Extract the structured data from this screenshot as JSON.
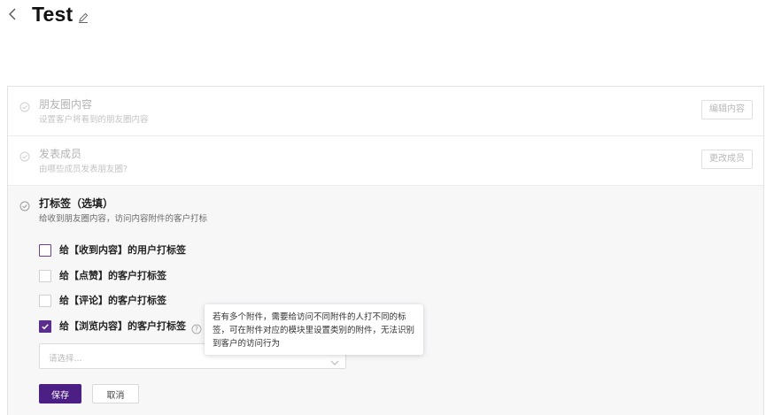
{
  "header": {
    "title": "Test"
  },
  "steps": [
    {
      "title": "朋友圈内容",
      "description": "设置客户将看到的朋友圈内容",
      "action_label": "编辑内容",
      "status_icon": "check-circle-icon"
    },
    {
      "title": "发表成员",
      "description": "由哪些成员发表朋友圈?",
      "action_label": "更改成员",
      "status_icon": "check-circle-icon"
    },
    {
      "title": "打标签（选填）",
      "description": "给收到朋友圈内容，访问内容附件的客户打标",
      "status_icon": "circle-icon",
      "options": [
        {
          "label": "给【收到内容】的用户打标签",
          "checked": false
        },
        {
          "label": "给【点赞】的客户打标签",
          "checked": false
        },
        {
          "label": "给【评论】的客户打标签",
          "checked": false
        },
        {
          "label": "给【浏览内容】的客户打标签",
          "checked": true
        }
      ],
      "select": {
        "placeholder": "请选择..."
      },
      "tooltip": "若有多个附件，需要给访问不同附件的人打不同的标签，可在附件对应的模块里设置类别的附件，无法识别到客户的访问行为",
      "save_label": "保存",
      "cancel_label": "取消"
    }
  ],
  "colors": {
    "accent": "#5b2d8e",
    "save_button": "#4c1f85"
  }
}
